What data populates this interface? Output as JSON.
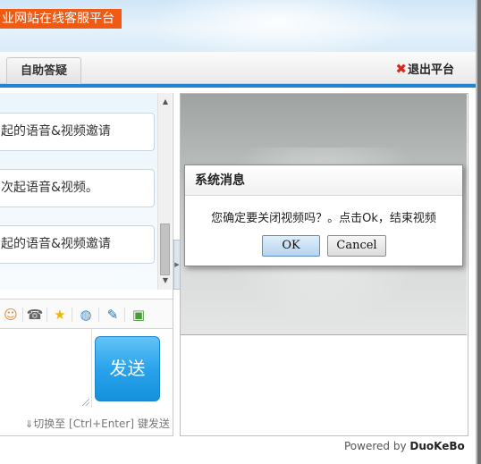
{
  "header": {
    "brand_text": "业网站在线客服平台"
  },
  "tabs": [
    {
      "label": "自助答疑"
    }
  ],
  "exit": {
    "icon": "✖",
    "label": "退出平台"
  },
  "messages": [
    {
      "text": "起的语音&视频邀请"
    },
    {
      "text": "次起语音&视频。"
    },
    {
      "text": "起的语音&视频邀请"
    }
  ],
  "toolbar": {
    "tools": [
      {
        "name": "emoji-icon",
        "glyph": "☺"
      },
      {
        "name": "phone-icon",
        "glyph": "☎"
      },
      {
        "name": "star-icon",
        "glyph": "★"
      },
      {
        "name": "globe-icon",
        "glyph": "◍"
      },
      {
        "name": "pin-icon",
        "glyph": "✎"
      },
      {
        "name": "image-icon",
        "glyph": "▣"
      }
    ]
  },
  "send_button": {
    "label": "发送"
  },
  "input_hint": {
    "arrow": "⇓",
    "text": "切换至 [Ctrl+Enter] 键发送"
  },
  "dialog": {
    "title": "系统消息",
    "message": "您确定要关闭视频吗？。点击Ok，结束视频",
    "ok_label": "OK",
    "cancel_label": "Cancel"
  },
  "footer": {
    "powered_by": "Powered by",
    "brand": "DuoKeBo"
  },
  "colors": {
    "accent_blue": "#1f86d4",
    "brand_orange": "#ef5a14",
    "exit_red": "#d8261c",
    "send_blue": "#2aa3ec"
  }
}
